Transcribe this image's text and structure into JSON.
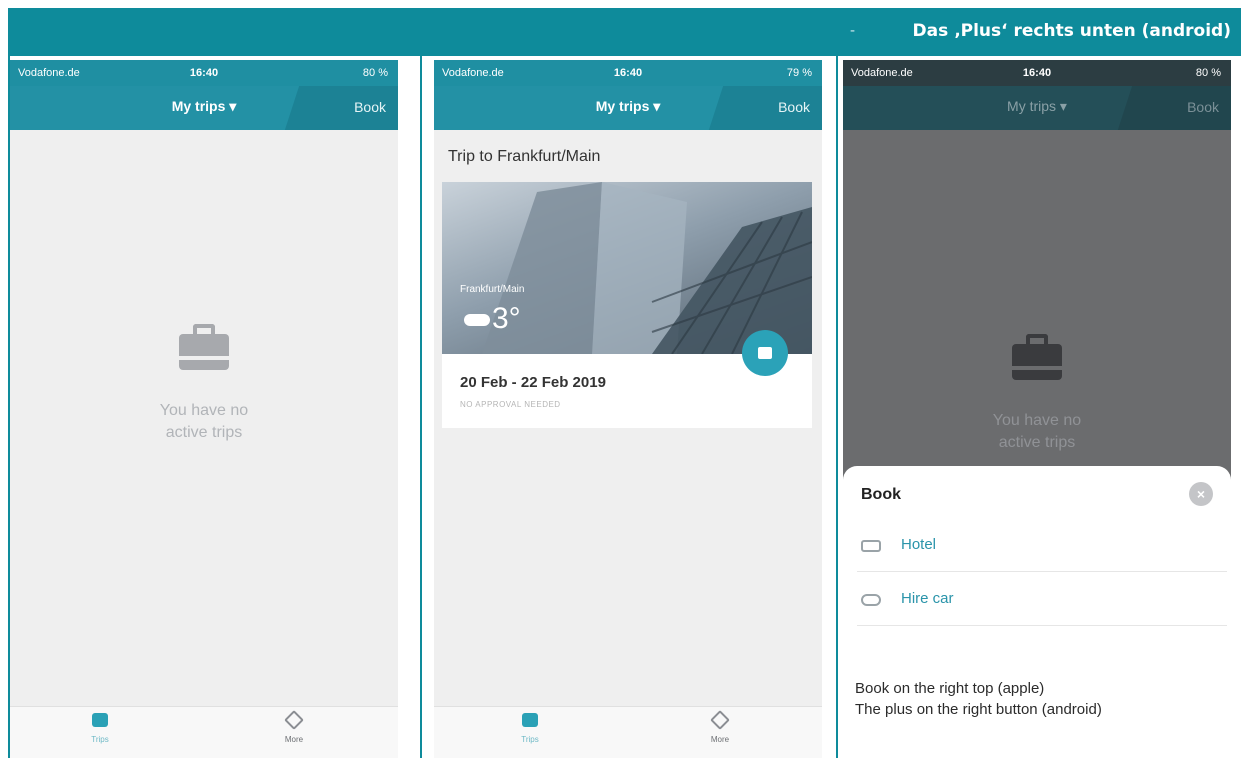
{
  "banner": {
    "dash": "-",
    "title": "Das ‚Plus‘ rechts unten (android)"
  },
  "phones": {
    "p1": {
      "status": {
        "carrier": "Vodafone.de",
        "time": "16:40",
        "battery": "80 %"
      },
      "nav": {
        "title": "My trips ▾",
        "book": "Book"
      },
      "empty_text_1": "You have no",
      "empty_text_2": "active trips",
      "tabs": {
        "trips": "Trips",
        "more": "More"
      }
    },
    "p2": {
      "status": {
        "carrier": "Vodafone.de",
        "time": "16:40",
        "battery": "79 %"
      },
      "nav": {
        "title": "My trips ▾",
        "book": "Book"
      },
      "trip_heading": "Trip to Frankfurt/Main",
      "card": {
        "city": "Frankfurt/Main",
        "temp": "3°",
        "dates": "20 Feb - 22 Feb 2019",
        "status": "NO APPROVAL NEEDED"
      },
      "tabs": {
        "trips": "Trips",
        "more": "More"
      }
    },
    "p3": {
      "status": {
        "carrier": "Vodafone.de",
        "time": "16:40",
        "battery": "80 %"
      },
      "nav": {
        "title": "My trips ▾",
        "book": "Book"
      },
      "empty_text_1": "You have no",
      "empty_text_2": "active trips",
      "sheet": {
        "title": "Book",
        "close": "×",
        "items": [
          {
            "label": "Hotel",
            "icon": "bed-icon"
          },
          {
            "label": "Hire car",
            "icon": "car-icon"
          }
        ],
        "note_1": "Book on the right top (apple)",
        "note_2": "The plus on the right button (android)"
      }
    }
  },
  "colors": {
    "teal": "#0e8b9b",
    "nav": "#2391a5",
    "accent": "#2ba2b8"
  }
}
